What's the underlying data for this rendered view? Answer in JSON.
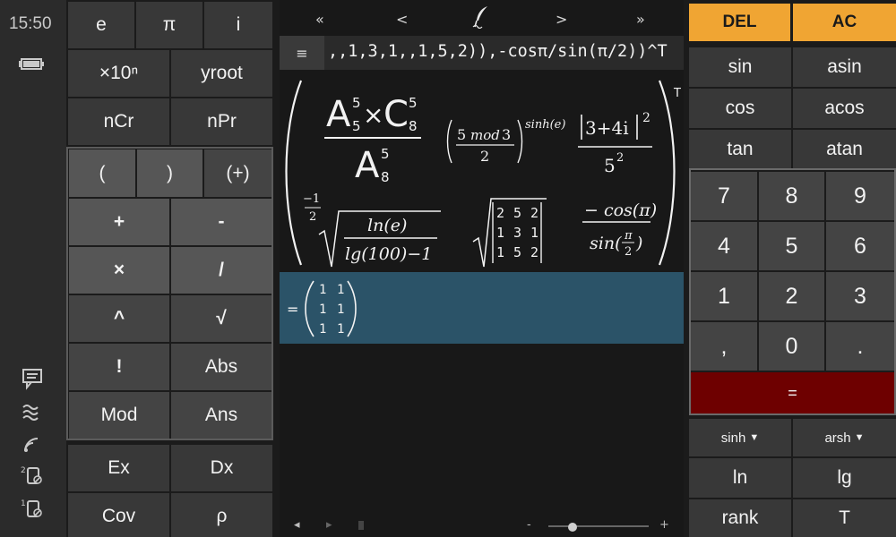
{
  "status": {
    "time": "15:50"
  },
  "left_keys": [
    {
      "name": "e-key",
      "label": "e"
    },
    {
      "name": "pi-key",
      "label": "π"
    },
    {
      "name": "i-key",
      "label": "i"
    },
    {
      "name": "times-ten-power-key",
      "label": "×10ⁿ"
    },
    {
      "name": "yroot-key",
      "label": "yroot"
    },
    {
      "name": "ncr-key",
      "label": "nCr"
    },
    {
      "name": "npr-key",
      "label": "nPr"
    },
    {
      "name": "open-paren-key",
      "label": "("
    },
    {
      "name": "close-paren-key",
      "label": ")"
    },
    {
      "name": "paren-wrap-key",
      "label": "(+)"
    },
    {
      "name": "plus-key",
      "label": "+"
    },
    {
      "name": "minus-key",
      "label": "-"
    },
    {
      "name": "multiply-key",
      "label": "×"
    },
    {
      "name": "divide-key",
      "label": "/"
    },
    {
      "name": "power-key",
      "label": "^"
    },
    {
      "name": "sqrt-key",
      "label": "√"
    },
    {
      "name": "factorial-key",
      "label": "!"
    },
    {
      "name": "abs-key",
      "label": "Abs"
    },
    {
      "name": "mod-key",
      "label": "Mod"
    },
    {
      "name": "ans-key",
      "label": "Ans"
    },
    {
      "name": "ex-key",
      "label": "Ex"
    },
    {
      "name": "dx-key",
      "label": "Dx"
    },
    {
      "name": "cov-key",
      "label": "Cov"
    },
    {
      "name": "rho-key",
      "label": "ρ"
    }
  ],
  "nav": {
    "first": "«",
    "prev": "<",
    "next": ">",
    "last": "»"
  },
  "expression": {
    "menu_label": "≡",
    "text": ",,1,3,1,,1,5,2)),-cosπ/sin(π/2))^T"
  },
  "display": {
    "A": "A",
    "C": "C",
    "five": "5",
    "eight": "8",
    "times": "×",
    "mod_base": "5",
    "mod_word": "mod",
    "mod_arg": "3",
    "two": "2",
    "sinh_e": "sinh(e)",
    "complex": "3+4i",
    "sq": "2",
    "five_sq_base": "5",
    "neg_one": "−1",
    "ln_e": "ln(e)",
    "lg100": "lg(100)−1",
    "matrix": [
      [
        "2",
        "5",
        "2"
      ],
      [
        "1",
        "3",
        "1"
      ],
      [
        "1",
        "5",
        "2"
      ]
    ],
    "neg_cos_pi": "− cos(π)",
    "sin_pre": "sin(",
    "sin_post": ")",
    "pi": "π",
    "T": "T"
  },
  "result": {
    "equals": "=",
    "matrix": [
      [
        "1",
        "1"
      ],
      [
        "1",
        "1"
      ],
      [
        "1",
        "1"
      ]
    ]
  },
  "scroll": {
    "left": "◂",
    "right": "▸",
    "minus": "-",
    "plus": "+"
  },
  "right_keys": [
    {
      "name": "del-key",
      "label": "DEL"
    },
    {
      "name": "ac-key",
      "label": "AC"
    },
    {
      "name": "sin-key",
      "label": "sin"
    },
    {
      "name": "asin-key",
      "label": "asin"
    },
    {
      "name": "cos-key",
      "label": "cos"
    },
    {
      "name": "acos-key",
      "label": "acos"
    },
    {
      "name": "tan-key",
      "label": "tan"
    },
    {
      "name": "atan-key",
      "label": "atan"
    },
    {
      "name": "digit-7-key",
      "label": "7"
    },
    {
      "name": "digit-8-key",
      "label": "8"
    },
    {
      "name": "digit-9-key",
      "label": "9"
    },
    {
      "name": "digit-4-key",
      "label": "4"
    },
    {
      "name": "digit-5-key",
      "label": "5"
    },
    {
      "name": "digit-6-key",
      "label": "6"
    },
    {
      "name": "digit-1-key",
      "label": "1"
    },
    {
      "name": "digit-2-key",
      "label": "2"
    },
    {
      "name": "digit-3-key",
      "label": "3"
    },
    {
      "name": "comma-key",
      "label": ","
    },
    {
      "name": "digit-0-key",
      "label": "0"
    },
    {
      "name": "decimal-key",
      "label": "."
    },
    {
      "name": "equals-key",
      "label": "="
    },
    {
      "name": "sinh-dropdown",
      "label": "sinh"
    },
    {
      "name": "arsh-dropdown",
      "label": "arsh"
    },
    {
      "name": "ln-key",
      "label": "ln"
    },
    {
      "name": "lg-key",
      "label": "lg"
    },
    {
      "name": "rank-key",
      "label": "rank"
    },
    {
      "name": "transpose-key",
      "label": "T"
    }
  ]
}
